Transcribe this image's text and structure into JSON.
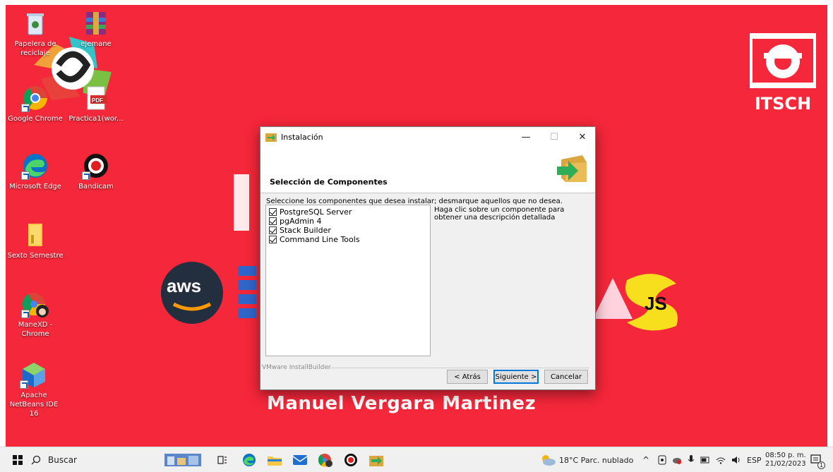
{
  "desktop": {
    "background_color": "#f5273a",
    "icons": [
      {
        "label": "Papelera de reciclaje",
        "icon": "recycle-bin-icon"
      },
      {
        "label": "ejemane",
        "icon": "winrar-archive-icon"
      },
      {
        "label": "Google Chrome",
        "icon": "chrome-icon"
      },
      {
        "label": "Practica1(wor...",
        "icon": "pdf-file-icon"
      },
      {
        "label": "Microsoft Edge",
        "icon": "edge-icon"
      },
      {
        "label": "Bandicam",
        "icon": "bandicam-icon"
      },
      {
        "label": "Sexto Semestre",
        "icon": "folder-icon"
      },
      {
        "label": "ManeXD - Chrome",
        "icon": "chrome-profile-icon"
      },
      {
        "label": "Apache NetBeans IDE 16",
        "icon": "netbeans-icon"
      }
    ],
    "wallpaper": {
      "name": "Manuel Vergara Martinez",
      "logo_text": "ITSCH",
      "aws_text": "aws",
      "js_text": "JS"
    }
  },
  "dialog": {
    "title": "Instalación",
    "controls": {
      "minimize": "—",
      "maximize": "☐",
      "close": "✕"
    },
    "header_title": "Selección de Componentes",
    "instructions": "Seleccione los componentes que desea instalar; desmarque aquellos que no desea.",
    "components": [
      {
        "label": "PostgreSQL Server",
        "checked": true
      },
      {
        "label": "pgAdmin 4",
        "checked": true
      },
      {
        "label": "Stack Builder",
        "checked": true
      },
      {
        "label": "Command Line Tools",
        "checked": true
      }
    ],
    "description": "Haga clic sobre un componente para obtener una descripción detallada",
    "brand": "VMware InstallBuilder",
    "buttons": {
      "back": "< Atrás",
      "next": "Siguiente >",
      "cancel": "Cancelar"
    }
  },
  "taskbar": {
    "search_placeholder": "Buscar",
    "weather": "18°C Parc. nublado",
    "language": "ESP",
    "time": "08:50 p. m.",
    "date": "21/02/2023",
    "notification_count": "1"
  }
}
